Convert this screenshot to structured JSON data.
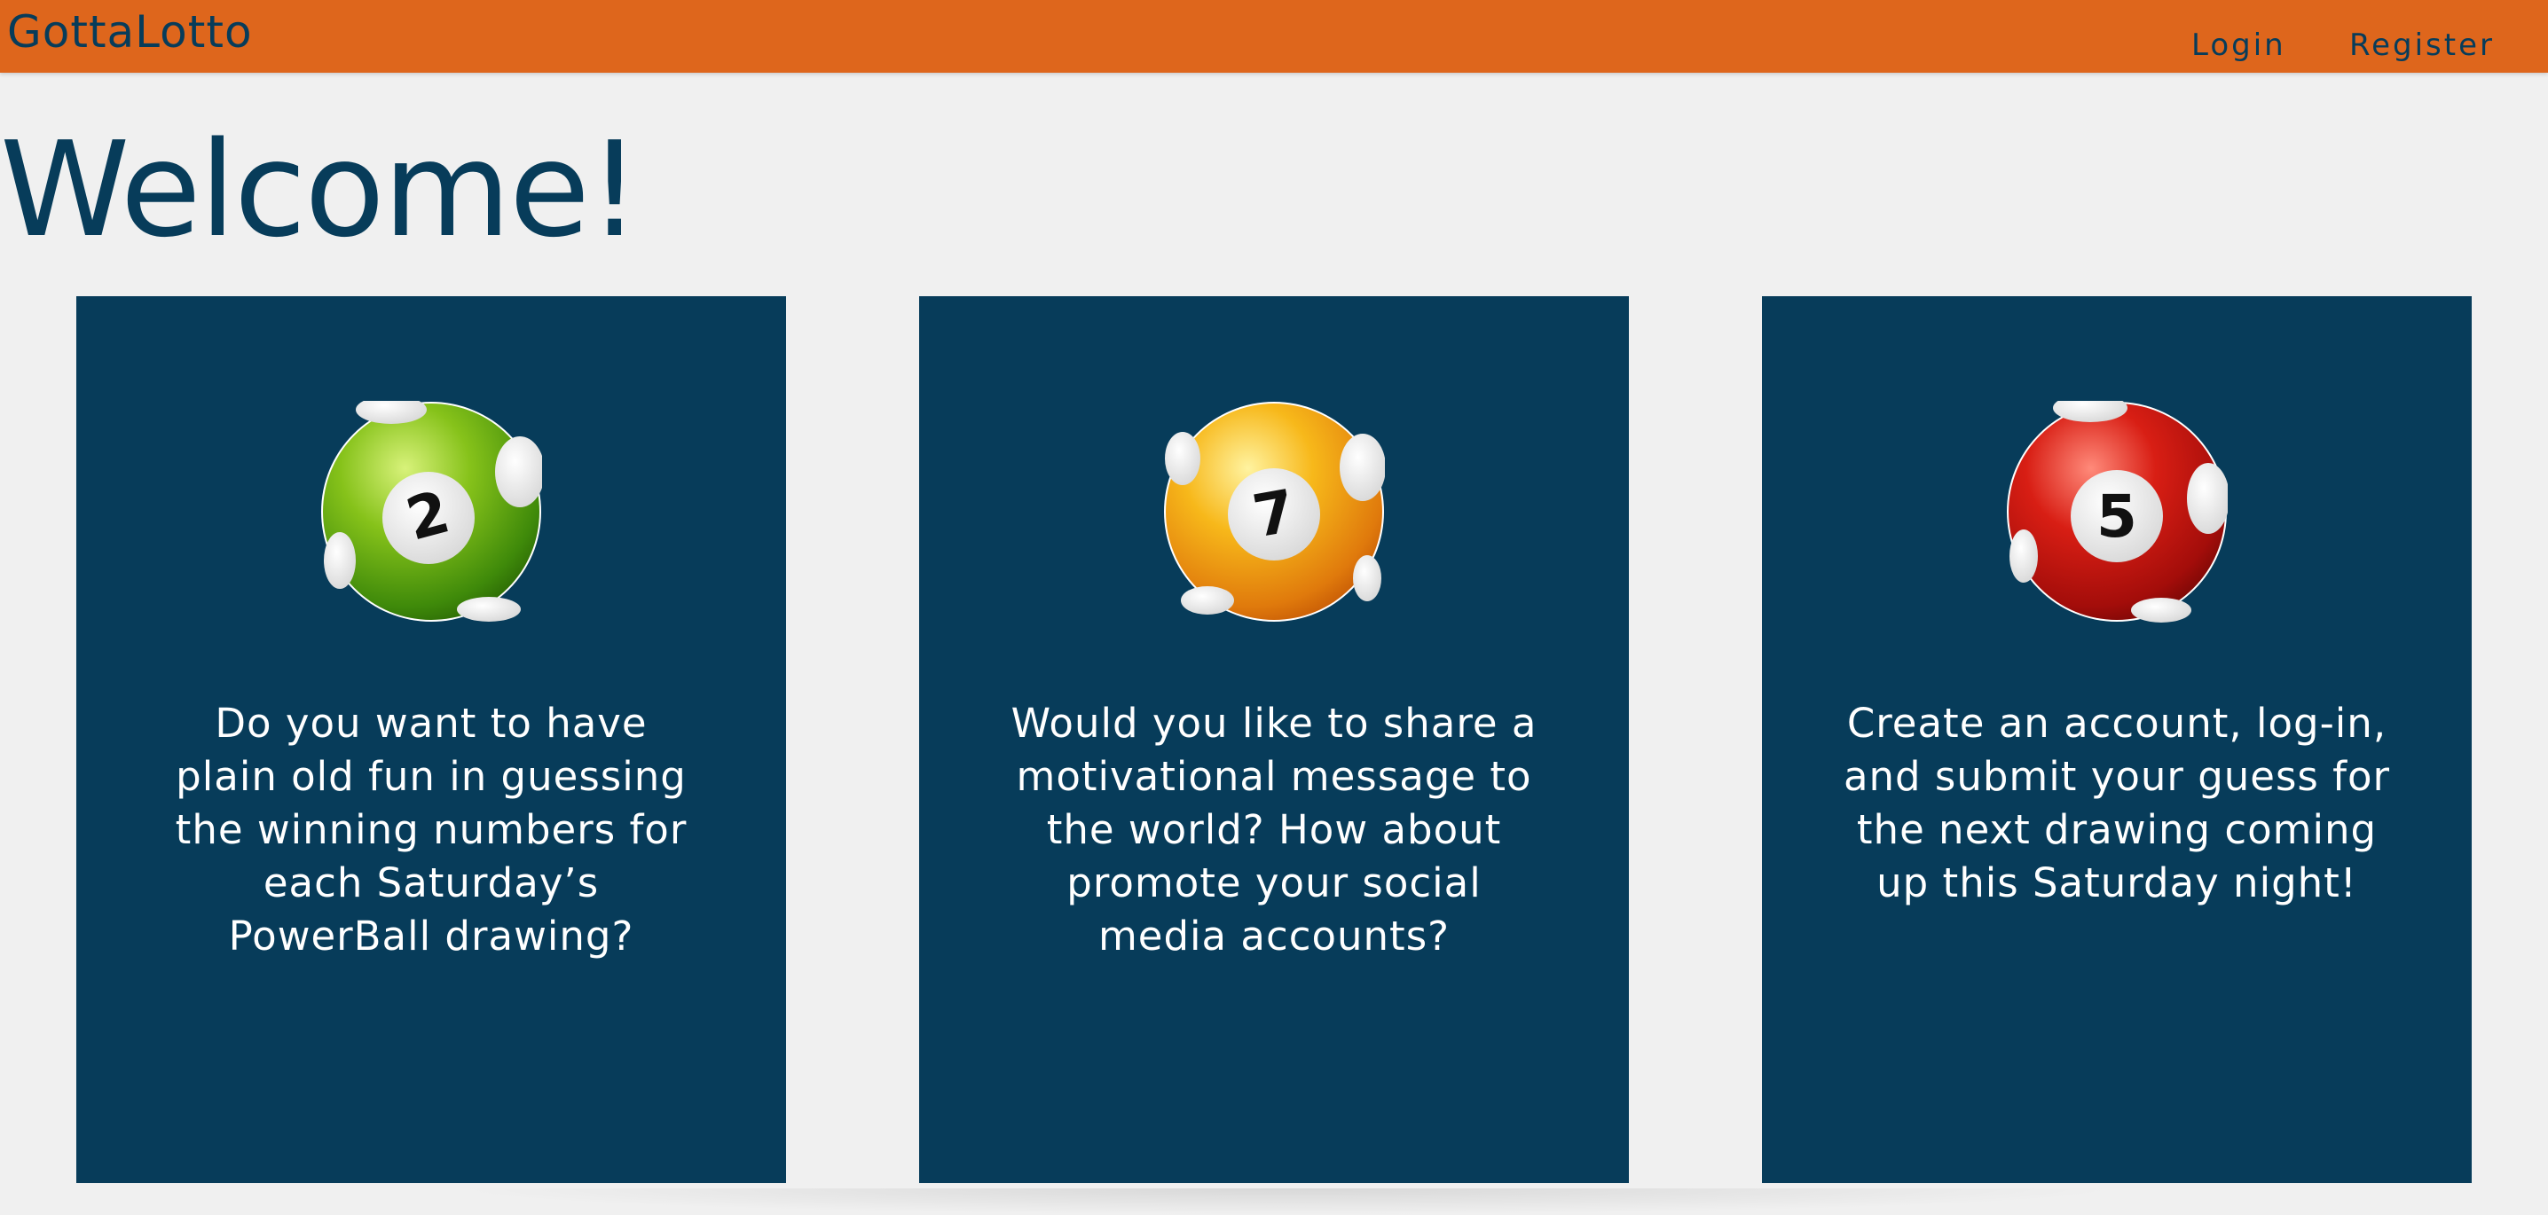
{
  "navbar": {
    "brand": "GottaLotto",
    "links": [
      {
        "label": "Login"
      },
      {
        "label": "Register"
      }
    ],
    "color": "#de661c"
  },
  "main": {
    "heading": "Welcome!",
    "cards": [
      {
        "ball_number": "2",
        "ball_color": "green",
        "text": "Do you want to have plain old fun in guessing the winning numbers for each Saturday’s PowerBall drawing?"
      },
      {
        "ball_number": "7",
        "ball_color": "yellow",
        "text": "Would you like to share a motivational message to the world? How about promote your social media accounts?"
      },
      {
        "ball_number": "5",
        "ball_color": "red",
        "text": "Create an account, log-in, and submit your guess for the next drawing coming up this Saturday night!"
      }
    ]
  },
  "colors": {
    "accent": "#de661c",
    "primary": "#073c5a",
    "background": "#f0f0f0"
  }
}
